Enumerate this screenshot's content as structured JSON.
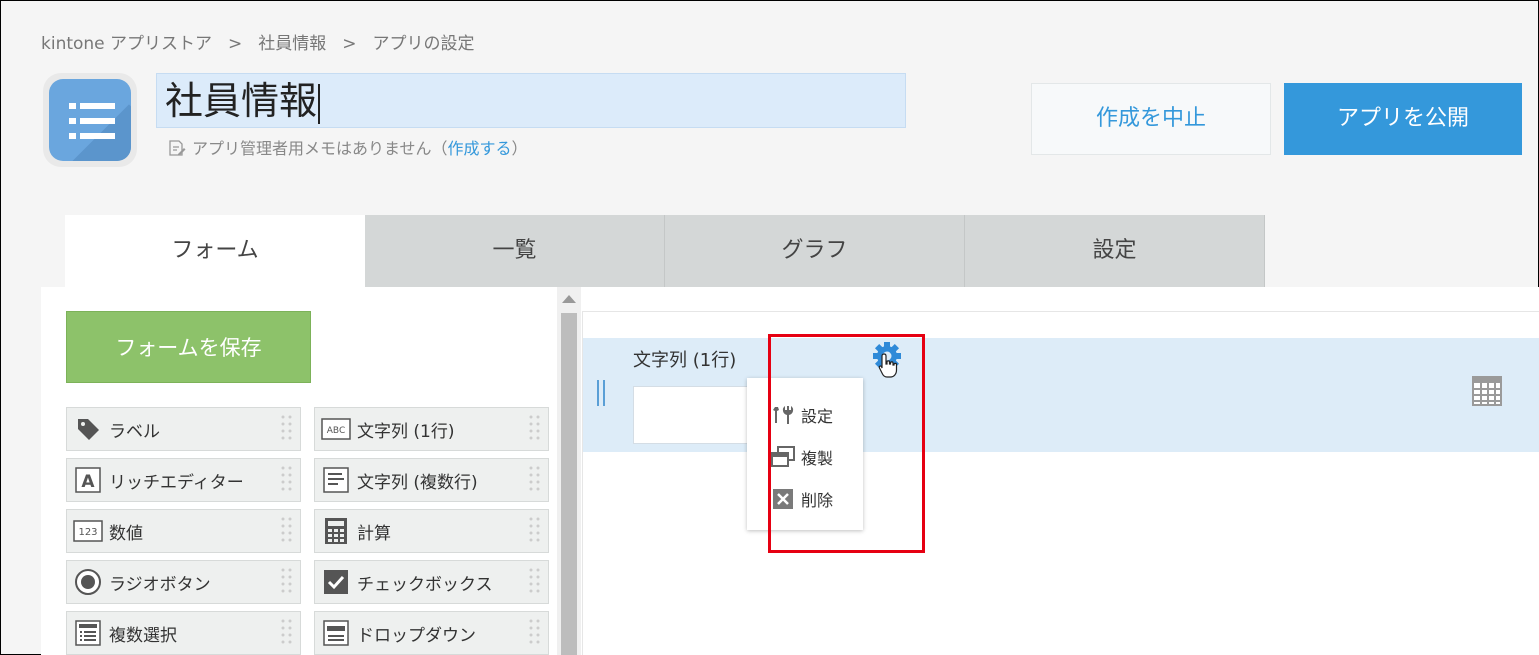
{
  "breadcrumb": [
    "kintone アプリストア",
    ">",
    "社員情報",
    ">",
    "アプリの設定"
  ],
  "app": {
    "title": "社員情報",
    "memo_text": "アプリ管理者用メモはありません（",
    "memo_link": "作成する",
    "memo_close": "）"
  },
  "header_buttons": {
    "cancel": "作成を中止",
    "publish": "アプリを公開"
  },
  "tabs": [
    "フォーム",
    "一覧",
    "グラフ",
    "設定"
  ],
  "palette": {
    "save_button": "フォームを保存",
    "items": [
      {
        "label": "ラベル",
        "icon": "tag-icon"
      },
      {
        "label": "文字列 (1行)",
        "icon": "abc-icon"
      },
      {
        "label": "リッチエディター",
        "icon": "rich-editor-icon"
      },
      {
        "label": "文字列 (複数行)",
        "icon": "multiline-text-icon"
      },
      {
        "label": "数値",
        "icon": "number-icon"
      },
      {
        "label": "計算",
        "icon": "calculator-icon"
      },
      {
        "label": "ラジオボタン",
        "icon": "radio-icon"
      },
      {
        "label": "チェックボックス",
        "icon": "checkbox-icon"
      },
      {
        "label": "複数選択",
        "icon": "multi-select-icon"
      },
      {
        "label": "ドロップダウン",
        "icon": "dropdown-icon"
      }
    ]
  },
  "canvas": {
    "field_label": "文字列 (1行)"
  },
  "context_menu": [
    "設定",
    "複製",
    "削除"
  ],
  "colors": {
    "primary": "#3498db",
    "save_green": "#8dc26a",
    "highlight_red": "#e60012"
  }
}
